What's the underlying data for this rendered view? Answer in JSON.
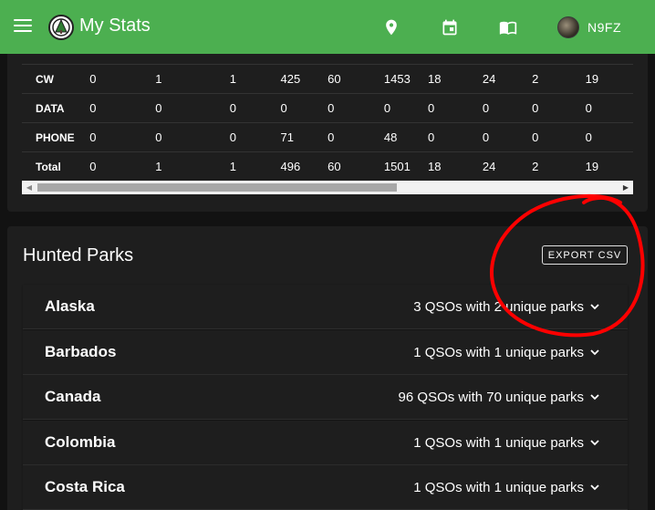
{
  "appbar": {
    "title": "My Stats",
    "callsign": "N9FZ",
    "color": "#4caf50",
    "icons": [
      "menu-icon",
      "location-pin-icon",
      "calendar-icon",
      "book-icon"
    ]
  },
  "stats_table": {
    "rows": [
      {
        "label": "CW",
        "values": [
          "0",
          "1",
          "1",
          "425",
          "60",
          "1453",
          "18",
          "24",
          "2",
          "19"
        ]
      },
      {
        "label": "DATA",
        "values": [
          "0",
          "0",
          "0",
          "0",
          "0",
          "0",
          "0",
          "0",
          "0",
          "0"
        ]
      },
      {
        "label": "PHONE",
        "values": [
          "0",
          "0",
          "0",
          "71",
          "0",
          "48",
          "0",
          "0",
          "0",
          "0"
        ]
      },
      {
        "label": "Total",
        "values": [
          "0",
          "1",
          "1",
          "496",
          "60",
          "1501",
          "18",
          "24",
          "2",
          "19"
        ]
      }
    ],
    "horizontal_scroll_fraction": 0.6
  },
  "parks": {
    "title": "Hunted Parks",
    "export_label": "EXPORT CSV",
    "items": [
      {
        "name": "Alaska",
        "summary": "3 QSOs with 2 unique parks"
      },
      {
        "name": "Barbados",
        "summary": "1 QSOs with 1 unique parks"
      },
      {
        "name": "Canada",
        "summary": "96 QSOs with 70 unique parks"
      },
      {
        "name": "Colombia",
        "summary": "1 QSOs with 1 unique parks"
      },
      {
        "name": "Costa Rica",
        "summary": "1 QSOs with 1 unique parks"
      }
    ]
  },
  "annotation_color": "#ff0000"
}
